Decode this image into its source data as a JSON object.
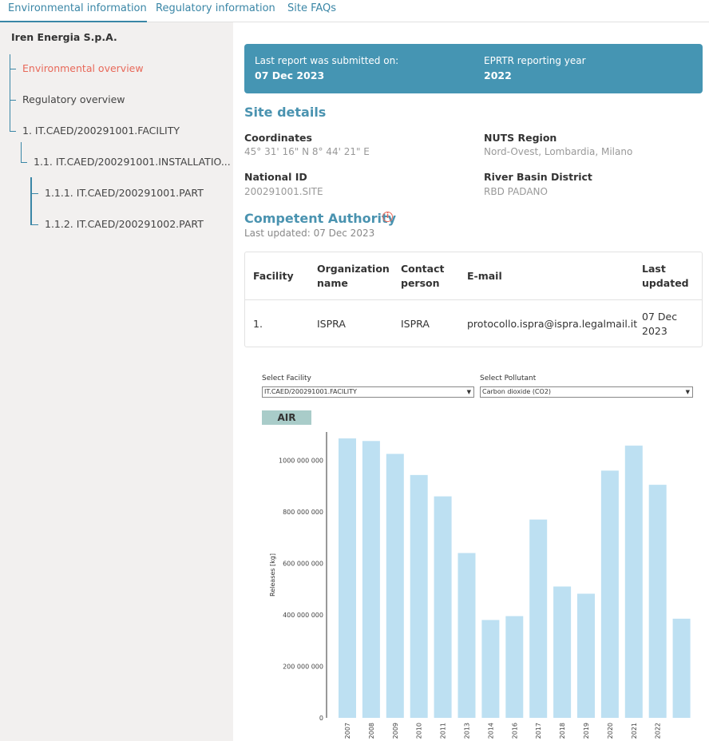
{
  "tabs": [
    {
      "label": "Environmental information",
      "active": true
    },
    {
      "label": "Regulatory information",
      "active": false
    },
    {
      "label": "Site FAQs",
      "active": false
    }
  ],
  "sidebar": {
    "company": "Iren Energia S.p.A.",
    "items": [
      {
        "label": "Environmental overview",
        "active": true
      },
      {
        "label": "Regulatory overview"
      },
      {
        "label": "1. IT.CAED/200291001.FACILITY"
      },
      {
        "label": "1.1. IT.CAED/200291001.INSTALLATIO..."
      },
      {
        "label": "1.1.1. IT.CAED/200291001.PART"
      },
      {
        "label": "1.1.2. IT.CAED/200291002.PART"
      }
    ]
  },
  "banner": {
    "submitted_label": "Last report was submitted on:",
    "submitted_value": "07 Dec 2023",
    "year_label": "EPRTR reporting year",
    "year_value": "2022"
  },
  "site_details": {
    "title": "Site details",
    "coordinates_label": "Coordinates",
    "coordinates_value": "45° 31' 16\" N 8° 44' 21\" E",
    "nuts_label": "NUTS Region",
    "nuts_value": "Nord-Ovest, Lombardia, Milano",
    "national_id_label": "National ID",
    "national_id_value": "200291001.SITE",
    "river_label": "River Basin District",
    "river_value": "RBD PADANO"
  },
  "authority": {
    "title": "Competent Authority",
    "info_icon": "info-icon",
    "updated": "Last updated: 07 Dec 2023",
    "columns": [
      "Facility",
      "Organization name",
      "Contact person",
      "E-mail",
      "Last updated"
    ],
    "rows": [
      [
        "1.",
        "ISPRA",
        "ISPRA",
        "protocollo.ispra@ispra.legalmail.it",
        "07 Dec 2023"
      ]
    ]
  },
  "filters": {
    "facility_label": "Select Facility",
    "facility_value": "IT.CAED/200291001.FACILITY",
    "pollutant_label": "Select Pollutant",
    "pollutant_value": "Carbon dioxide (CO2)",
    "medium_badge": "AIR"
  },
  "colors": {
    "accent": "#4595b3",
    "active_nav": "#e8695a",
    "bar": "#bde0f2",
    "badge": "#a9ccc9"
  },
  "chart_data": {
    "type": "bar",
    "title": "",
    "xlabel": "",
    "ylabel": "Releases [kg]",
    "categories": [
      "2007",
      "2008",
      "2009",
      "2010",
      "2011",
      "2013",
      "2014",
      "2016",
      "2017",
      "2018",
      "2019",
      "2020",
      "2021",
      "2022"
    ],
    "values": [
      1085000000,
      1075000000,
      1025000000,
      943000000,
      860000000,
      640000000,
      380000000,
      395000000,
      770000000,
      510000000,
      482000000,
      960000000,
      1057000000,
      905000000,
      385000000
    ],
    "ylim": [
      0,
      1110000000
    ],
    "yticks": [
      0,
      200000000,
      400000000,
      600000000,
      800000000,
      1000000000
    ],
    "ytick_labels": [
      "0",
      "200 000 000",
      "400 000 000",
      "600 000 000",
      "800 000 000",
      "1000 000 000"
    ],
    "grid": false
  }
}
